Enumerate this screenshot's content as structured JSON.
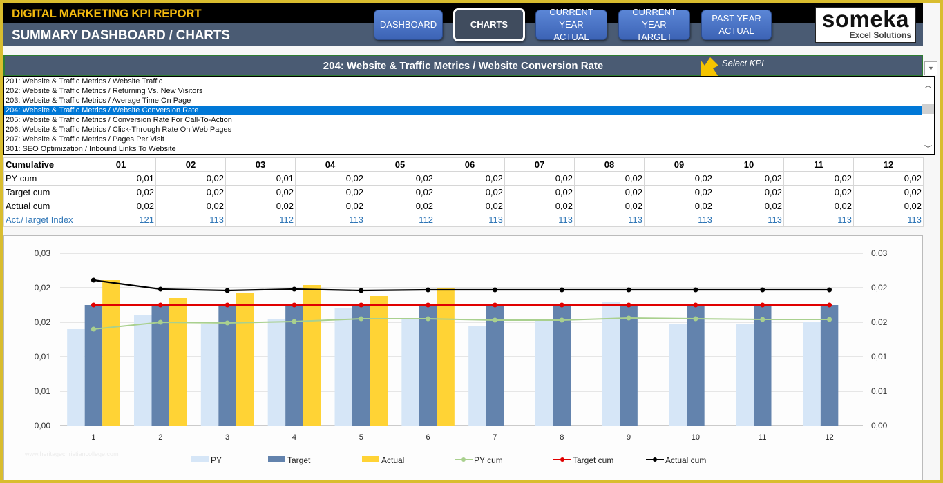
{
  "header": {
    "app_title": "DIGITAL MARKETING KPI REPORT",
    "page_title": "SUMMARY DASHBOARD / CHARTS",
    "nav": [
      {
        "label": "DASHBOARD",
        "active": false
      },
      {
        "label": "CHARTS",
        "active": true
      },
      {
        "label": "CURRENT YEAR\nACTUAL",
        "active": false
      },
      {
        "label": "CURRENT YEAR\nTARGET",
        "active": false
      },
      {
        "label": "PAST YEAR\nACTUAL",
        "active": false
      }
    ],
    "logo": {
      "word": "someka",
      "sub": "Excel Solutions"
    }
  },
  "kpi_selector": {
    "selected": "204: Website & Traffic Metrics / Website Conversion Rate",
    "hint": "Select KPI",
    "dropdown_icon": "chevron-down-icon",
    "options": [
      "201: Website & Traffic Metrics / Website Traffic",
      "202: Website & Traffic Metrics / Returning Vs. New Visitors",
      "203: Website & Traffic Metrics / Average Time On Page",
      "204: Website & Traffic Metrics / Website Conversion Rate",
      "205: Website & Traffic Metrics / Conversion Rate For Call-To-Action",
      "206: Website & Traffic Metrics / Click-Through Rate On Web Pages",
      "207: Website & Traffic Metrics / Pages Per Visit",
      "301: SEO Optimization / Inbound Links To Website"
    ],
    "selected_index": 3,
    "scroll_up": "^",
    "scroll_down": "v"
  },
  "table": {
    "header_label": "Cumulative",
    "months": [
      "01",
      "02",
      "03",
      "04",
      "05",
      "06",
      "07",
      "08",
      "09",
      "10",
      "11",
      "12"
    ],
    "rows": [
      {
        "label": "PY cum",
        "values": [
          "0,01",
          "0,02",
          "0,01",
          "0,02",
          "0,02",
          "0,02",
          "0,02",
          "0,02",
          "0,02",
          "0,02",
          "0,02",
          "0,02"
        ],
        "style": "normal"
      },
      {
        "label": "Target cum",
        "values": [
          "0,02",
          "0,02",
          "0,02",
          "0,02",
          "0,02",
          "0,02",
          "0,02",
          "0,02",
          "0,02",
          "0,02",
          "0,02",
          "0,02"
        ],
        "style": "normal"
      },
      {
        "label": "Actual cum",
        "values": [
          "0,02",
          "0,02",
          "0,02",
          "0,02",
          "0,02",
          "0,02",
          "0,02",
          "0,02",
          "0,02",
          "0,02",
          "0,02",
          "0,02"
        ],
        "style": "normal"
      },
      {
        "label": "Act./Target Index",
        "values": [
          "121",
          "113",
          "112",
          "113",
          "112",
          "113",
          "113",
          "113",
          "113",
          "113",
          "113",
          "113"
        ],
        "style": "index"
      }
    ]
  },
  "watermark": "www.heritagechristiancollege.com",
  "colors": {
    "py": "#d6e6f7",
    "target": "#6383ad",
    "actual": "#ffd335",
    "py_cum": "#a9d08e",
    "target_cum": "#e00000",
    "actual_cum": "#000000",
    "header_accent": "#f2b90f",
    "selection": "#0078d7"
  },
  "chart_data": {
    "type": "bar",
    "title": "",
    "xlabel": "",
    "ylabel": "",
    "categories": [
      "1",
      "2",
      "3",
      "4",
      "5",
      "6",
      "7",
      "8",
      "9",
      "10",
      "11",
      "12"
    ],
    "ylim": [
      0,
      0.025
    ],
    "yticks": [
      0,
      0.005,
      0.01,
      0.015,
      0.02,
      0.025
    ],
    "ytick_labels": [
      "0,00",
      "0,01",
      "0,01",
      "0,02",
      "0,02",
      "0,03"
    ],
    "secondary_ytick_labels": [
      "0,00",
      "0,01",
      "0,01",
      "0,02",
      "0,02",
      "0,03"
    ],
    "grid": true,
    "legend": "bottom",
    "series": [
      {
        "name": "PY",
        "kind": "bar",
        "values": [
          0.014,
          0.0161,
          0.0147,
          0.0155,
          0.0171,
          0.0154,
          0.0145,
          0.0152,
          0.018,
          0.0147,
          0.0147,
          0.015
        ]
      },
      {
        "name": "Target",
        "kind": "bar",
        "values": [
          0.0175,
          0.0175,
          0.0175,
          0.0175,
          0.0175,
          0.0175,
          0.0175,
          0.0175,
          0.0175,
          0.0175,
          0.0175,
          0.0175
        ]
      },
      {
        "name": "Actual",
        "kind": "bar",
        "values": [
          0.0211,
          0.0185,
          0.0192,
          0.0204,
          0.0188,
          0.02,
          null,
          null,
          null,
          null,
          null,
          null
        ]
      },
      {
        "name": "PY cum",
        "kind": "line",
        "values": [
          0.014,
          0.015,
          0.0149,
          0.0151,
          0.0155,
          0.0155,
          0.0153,
          0.0153,
          0.0156,
          0.0155,
          0.0154,
          0.0154
        ]
      },
      {
        "name": "Target cum",
        "kind": "line",
        "values": [
          0.0175,
          0.0175,
          0.0175,
          0.0175,
          0.0175,
          0.0175,
          0.0175,
          0.0175,
          0.0175,
          0.0175,
          0.0175,
          0.0175
        ]
      },
      {
        "name": "Actual cum",
        "kind": "line",
        "values": [
          0.0211,
          0.0198,
          0.0196,
          0.0198,
          0.0196,
          0.0197,
          0.0197,
          0.0197,
          0.0197,
          0.0197,
          0.0197,
          0.0197
        ]
      }
    ]
  }
}
